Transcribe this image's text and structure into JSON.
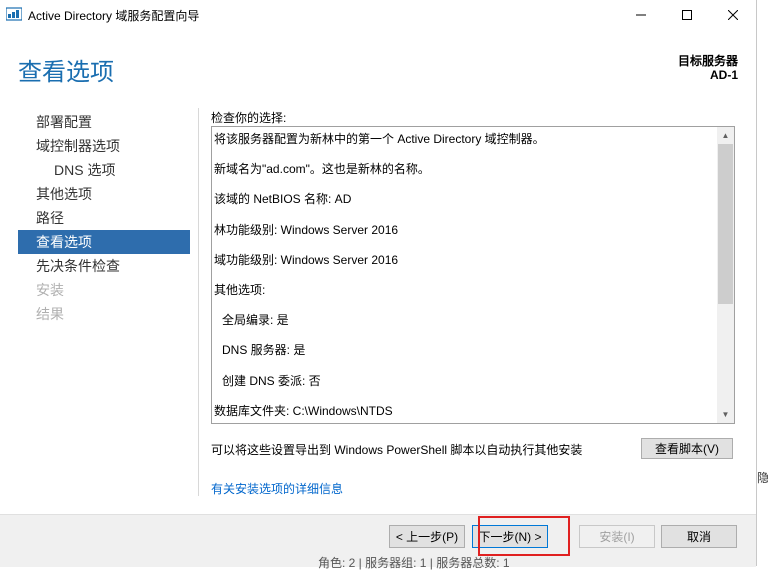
{
  "window": {
    "title": "Active Directory 域服务配置向导",
    "minimize_icon": "minimize-icon",
    "maximize_icon": "maximize-icon",
    "close_icon": "close-icon"
  },
  "header": {
    "page_title": "查看选项",
    "target_label": "目标服务器",
    "target_value": "AD-1"
  },
  "nav": {
    "items": [
      {
        "label": "部署配置",
        "state": "normal"
      },
      {
        "label": "域控制器选项",
        "state": "normal"
      },
      {
        "label": "DNS 选项",
        "state": "sub"
      },
      {
        "label": "其他选项",
        "state": "normal"
      },
      {
        "label": "路径",
        "state": "normal"
      },
      {
        "label": "查看选项",
        "state": "active"
      },
      {
        "label": "先决条件检查",
        "state": "normal"
      },
      {
        "label": "安装",
        "state": "disabled"
      },
      {
        "label": "结果",
        "state": "disabled"
      }
    ]
  },
  "review": {
    "label": "检查你的选择:",
    "lines": [
      "将该服务器配置为新林中的第一个 Active Directory 域控制器。",
      "新域名为\"ad.com\"。这也是新林的名称。",
      "该域的 NetBIOS 名称: AD",
      "林功能级别: Windows Server 2016",
      "域功能级别: Windows Server 2016",
      "其他选项:",
      "全局编录: 是",
      "DNS 服务器: 是",
      "创建 DNS 委派: 否",
      "数据库文件夹: C:\\Windows\\NTDS"
    ]
  },
  "export": {
    "text": "可以将这些设置导出到 Windows PowerShell 脚本以自动执行其他安装",
    "view_script_button": "查看脚本(V)"
  },
  "more_info_link": "有关安装选项的详细信息",
  "footer": {
    "prev_button": "< 上一步(P)",
    "next_button": "下一步(N) >",
    "install_button": "安装(I)",
    "cancel_button": "取消"
  },
  "background": {
    "strip_text": "隐",
    "bottom_text": "角色: 2 | 服务器组: 1 | 服务器总数: 1"
  },
  "colors": {
    "accent": "#1a6eb0",
    "active_nav": "#2e6dad",
    "highlight": "#e02020",
    "link": "#0066cc"
  }
}
